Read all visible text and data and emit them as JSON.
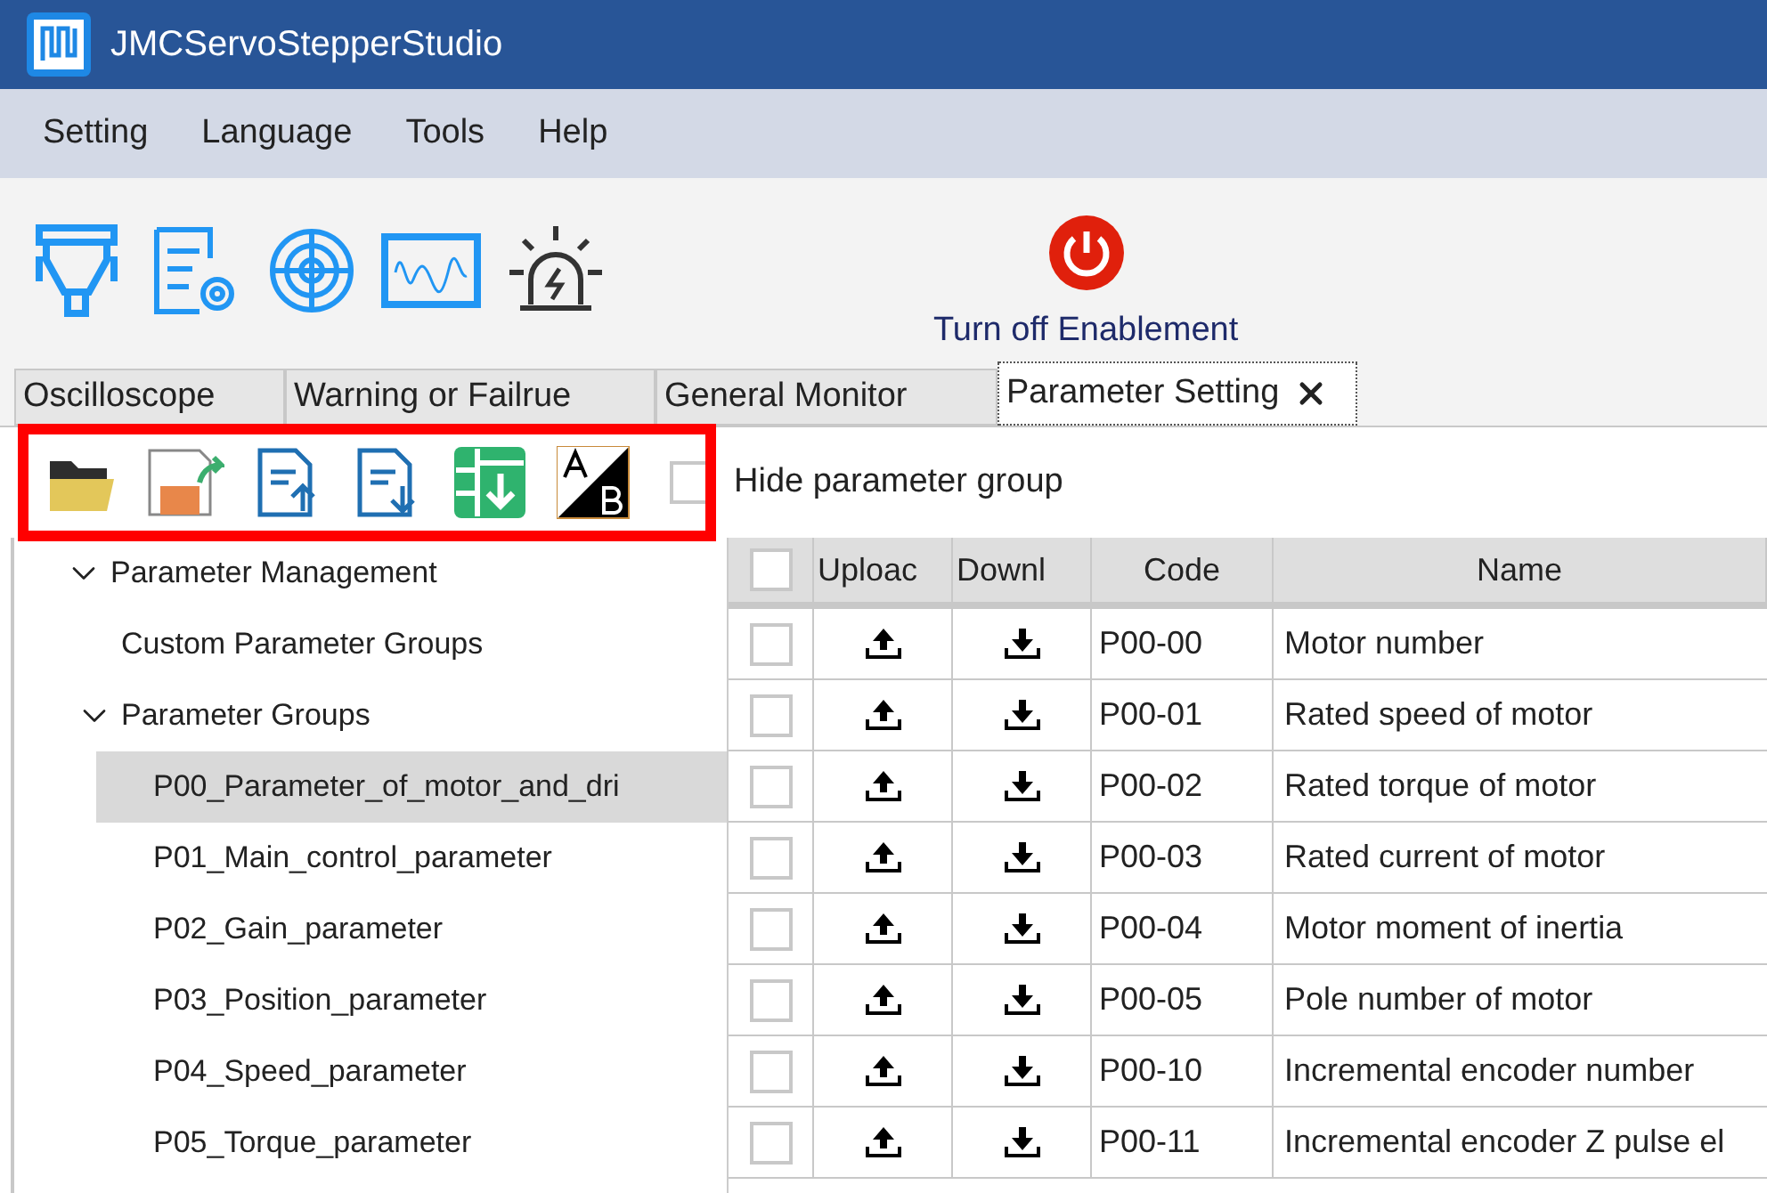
{
  "window": {
    "title": "JMCServoStepperStudio"
  },
  "menu": [
    "Setting",
    "Language",
    "Tools",
    "Help"
  ],
  "toolbar": {
    "enable_button": "Turn off Enablement"
  },
  "tabs": [
    {
      "label": "Oscilloscope",
      "selected": false,
      "closable": false
    },
    {
      "label": "Warning or Failrue",
      "selected": false,
      "closable": false
    },
    {
      "label": "General Monitor",
      "selected": false,
      "closable": false
    },
    {
      "label": "Parameter Setting",
      "selected": true,
      "closable": true
    }
  ],
  "hide_group": {
    "label": "Hide parameter group",
    "checked": false
  },
  "tree": [
    {
      "label": "Parameter Management",
      "expanded": true,
      "selected": false,
      "children": [
        {
          "label": "Custom Parameter Groups",
          "selected": false
        },
        {
          "label": "Parameter Groups",
          "expanded": true,
          "selected": false,
          "children": [
            {
              "label": "P00_Parameter_of_motor_and_dri",
              "selected": true
            },
            {
              "label": "P01_Main_control_parameter",
              "selected": false
            },
            {
              "label": "P02_Gain_parameter",
              "selected": false
            },
            {
              "label": "P03_Position_parameter",
              "selected": false
            },
            {
              "label": "P04_Speed_parameter",
              "selected": false
            },
            {
              "label": "P05_Torque_parameter",
              "selected": false
            }
          ]
        }
      ]
    }
  ],
  "table": {
    "select_all_checked": false,
    "columns": [
      "Uploac",
      "Downl",
      "Code",
      "Name"
    ],
    "rows": [
      {
        "checked": false,
        "code": "P00-00",
        "name": "Motor number"
      },
      {
        "checked": false,
        "code": "P00-01",
        "name": "Rated speed of motor"
      },
      {
        "checked": false,
        "code": "P00-02",
        "name": "Rated torque of motor"
      },
      {
        "checked": false,
        "code": "P00-03",
        "name": "Rated current of motor"
      },
      {
        "checked": false,
        "code": "P00-04",
        "name": "Motor moment of inertia"
      },
      {
        "checked": false,
        "code": "P00-05",
        "name": "Pole number of motor"
      },
      {
        "checked": false,
        "code": "P00-10",
        "name": "Incremental encoder number"
      },
      {
        "checked": false,
        "code": "P00-11",
        "name": "Incremental encoder Z pulse el"
      }
    ]
  }
}
